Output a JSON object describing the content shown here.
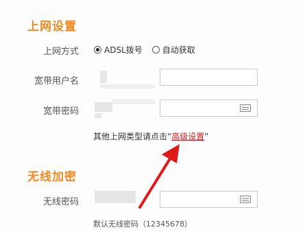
{
  "internet": {
    "title": "上网设置",
    "mode_label": "上网方式",
    "modes": [
      {
        "label": "ADSL拨号",
        "checked": true
      },
      {
        "label": "自动获取",
        "checked": false
      }
    ],
    "username_label": "宽带用户名",
    "password_label": "宽带密码",
    "advanced_prefix": "其他上网类型请点击“",
    "advanced_link": "高级设置",
    "advanced_suffix": "”"
  },
  "wireless": {
    "title": "无线加密",
    "password_label": "无线密码",
    "default_hint": "默认无线密码（12345678）"
  },
  "colors": {
    "section_title": "#f08a24",
    "link": "#cc1f1f",
    "arrow": "#e01818"
  },
  "icons": {
    "keyboard": "keyboard-icon"
  }
}
